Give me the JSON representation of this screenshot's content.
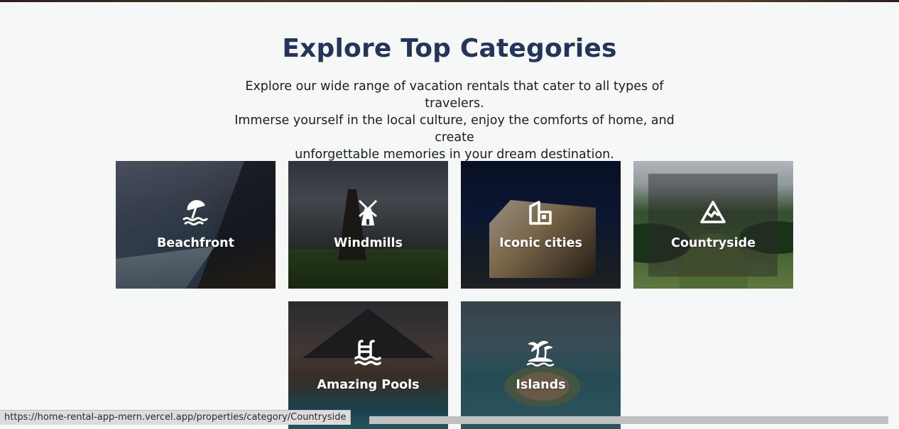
{
  "section": {
    "title": "Explore Top Categories",
    "intro_lines": [
      "Explore our wide range of vacation rentals that cater to all types of travelers.",
      "Immerse yourself in the local culture, enjoy the comforts of home, and create",
      "unforgettable memories in your dream destination."
    ]
  },
  "categories": [
    {
      "label": "Beachfront",
      "icon": "beach-umbrella-icon"
    },
    {
      "label": "Windmills",
      "icon": "windmill-icon"
    },
    {
      "label": "Iconic cities",
      "icon": "city-building-icon"
    },
    {
      "label": "Countryside",
      "icon": "mountain-icon"
    },
    {
      "label": "Amazing Pools",
      "icon": "pool-ladder-icon"
    },
    {
      "label": "Islands",
      "icon": "palm-island-icon"
    }
  ],
  "status_bar": {
    "url": "https://home-rental-app-mern.vercel.app/properties/category/Countryside"
  },
  "colors": {
    "title": "#24355a",
    "background": "#f6f7f7",
    "label": "#ffffff"
  }
}
